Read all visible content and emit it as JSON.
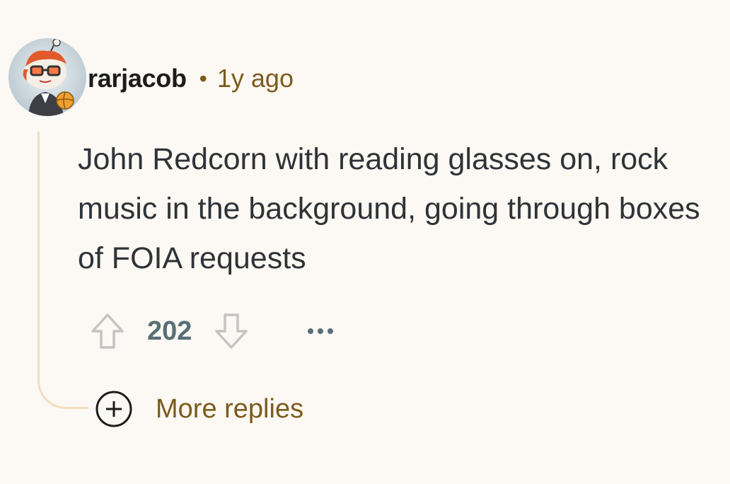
{
  "comment": {
    "author": "rarjacob",
    "separator": "•",
    "age": "1y ago",
    "body": "John Redcorn with reading glasses on, rock music in the background, going through boxes of FOIA requests",
    "score": "202"
  },
  "actions": {
    "upvote_icon": "arrow-up-outline-icon",
    "downvote_icon": "arrow-down-outline-icon",
    "more_icon": "ellipsis-icon"
  },
  "replies": {
    "more_label": "More replies",
    "expand_icon": "plus-circle-icon"
  },
  "colors": {
    "background": "#fcf8f3",
    "thread_line": "#f1dfbf",
    "meta_brown": "#7c5b1e",
    "body_text": "#2e3338",
    "score_text": "#576f76"
  }
}
